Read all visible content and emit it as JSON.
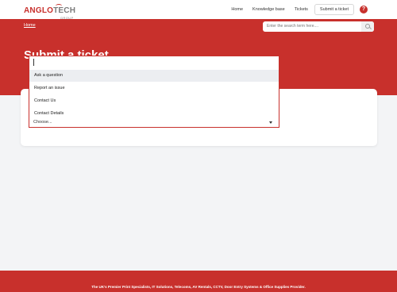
{
  "logo": {
    "part1": "ANGLO",
    "part2": "TECH",
    "sub": "GROUP"
  },
  "nav": {
    "items": [
      "Home",
      "Knowledge base",
      "Tickets"
    ],
    "submit_label": "Submit a ticket",
    "help_symbol": "?"
  },
  "breadcrumb": {
    "home": "Home"
  },
  "search": {
    "placeholder": "Enter the search term here...."
  },
  "hero": {
    "title": "Submit a ticket"
  },
  "form": {
    "select_value": "Choose...",
    "options": [
      "Ask a question",
      "Report an issue",
      "Contact Us",
      "Contact Details"
    ],
    "highlighted_index": 0
  },
  "footer": {
    "text": "The UK's Premier Print Specialists, IT Solutions, Telecoms, AV Rentals, CCTV, Door Entry Systems & Office Supplies Provider."
  },
  "colors": {
    "brand": "#c8302c",
    "background": "#f3f4f6"
  }
}
